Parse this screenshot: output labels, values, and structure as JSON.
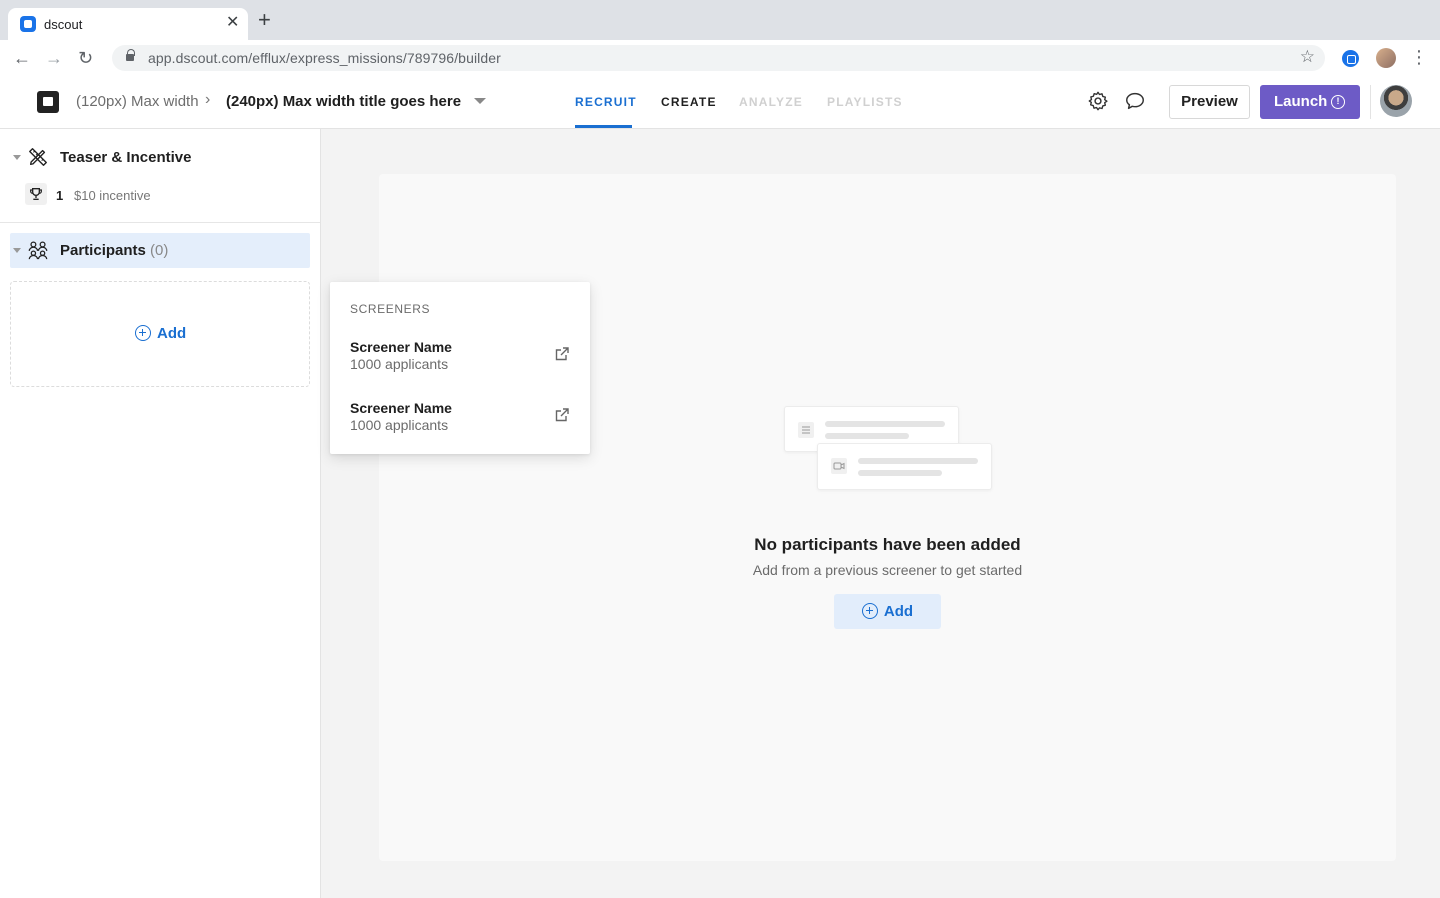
{
  "browser": {
    "tab_title": "dscout",
    "url": "app.dscout.com/efflux/express_missions/789796/builder"
  },
  "header": {
    "breadcrumb_parent": "(120px) Max width",
    "breadcrumb_title": "(240px) Max width title goes here",
    "tabs": [
      {
        "label": "RECRUIT",
        "state": "active"
      },
      {
        "label": "CREATE",
        "state": "normal"
      },
      {
        "label": "ANALYZE",
        "state": "disabled"
      },
      {
        "label": "PLAYLISTS",
        "state": "disabled"
      }
    ],
    "preview_label": "Preview",
    "launch_label": "Launch",
    "launch_info": "!"
  },
  "sidebar": {
    "teaser_title": "Teaser & Incentive",
    "incentive_count": "1",
    "incentive_text": "$10 incentive",
    "participants_label": "Participants",
    "participants_count": "(0)",
    "add_label": "Add"
  },
  "screeners": {
    "header": "SCREENERS",
    "items": [
      {
        "name": "Screener Name",
        "meta": "1000 applicants"
      },
      {
        "name": "Screener Name",
        "meta": "1000 applicants"
      }
    ]
  },
  "empty_state": {
    "title": "No participants have been added",
    "subtitle": "Add from a previous screener to get started",
    "add_label": "Add"
  },
  "colors": {
    "accent": "#1a6fd1",
    "launch": "#6d5bc6",
    "selected_row": "#e4eefb"
  }
}
